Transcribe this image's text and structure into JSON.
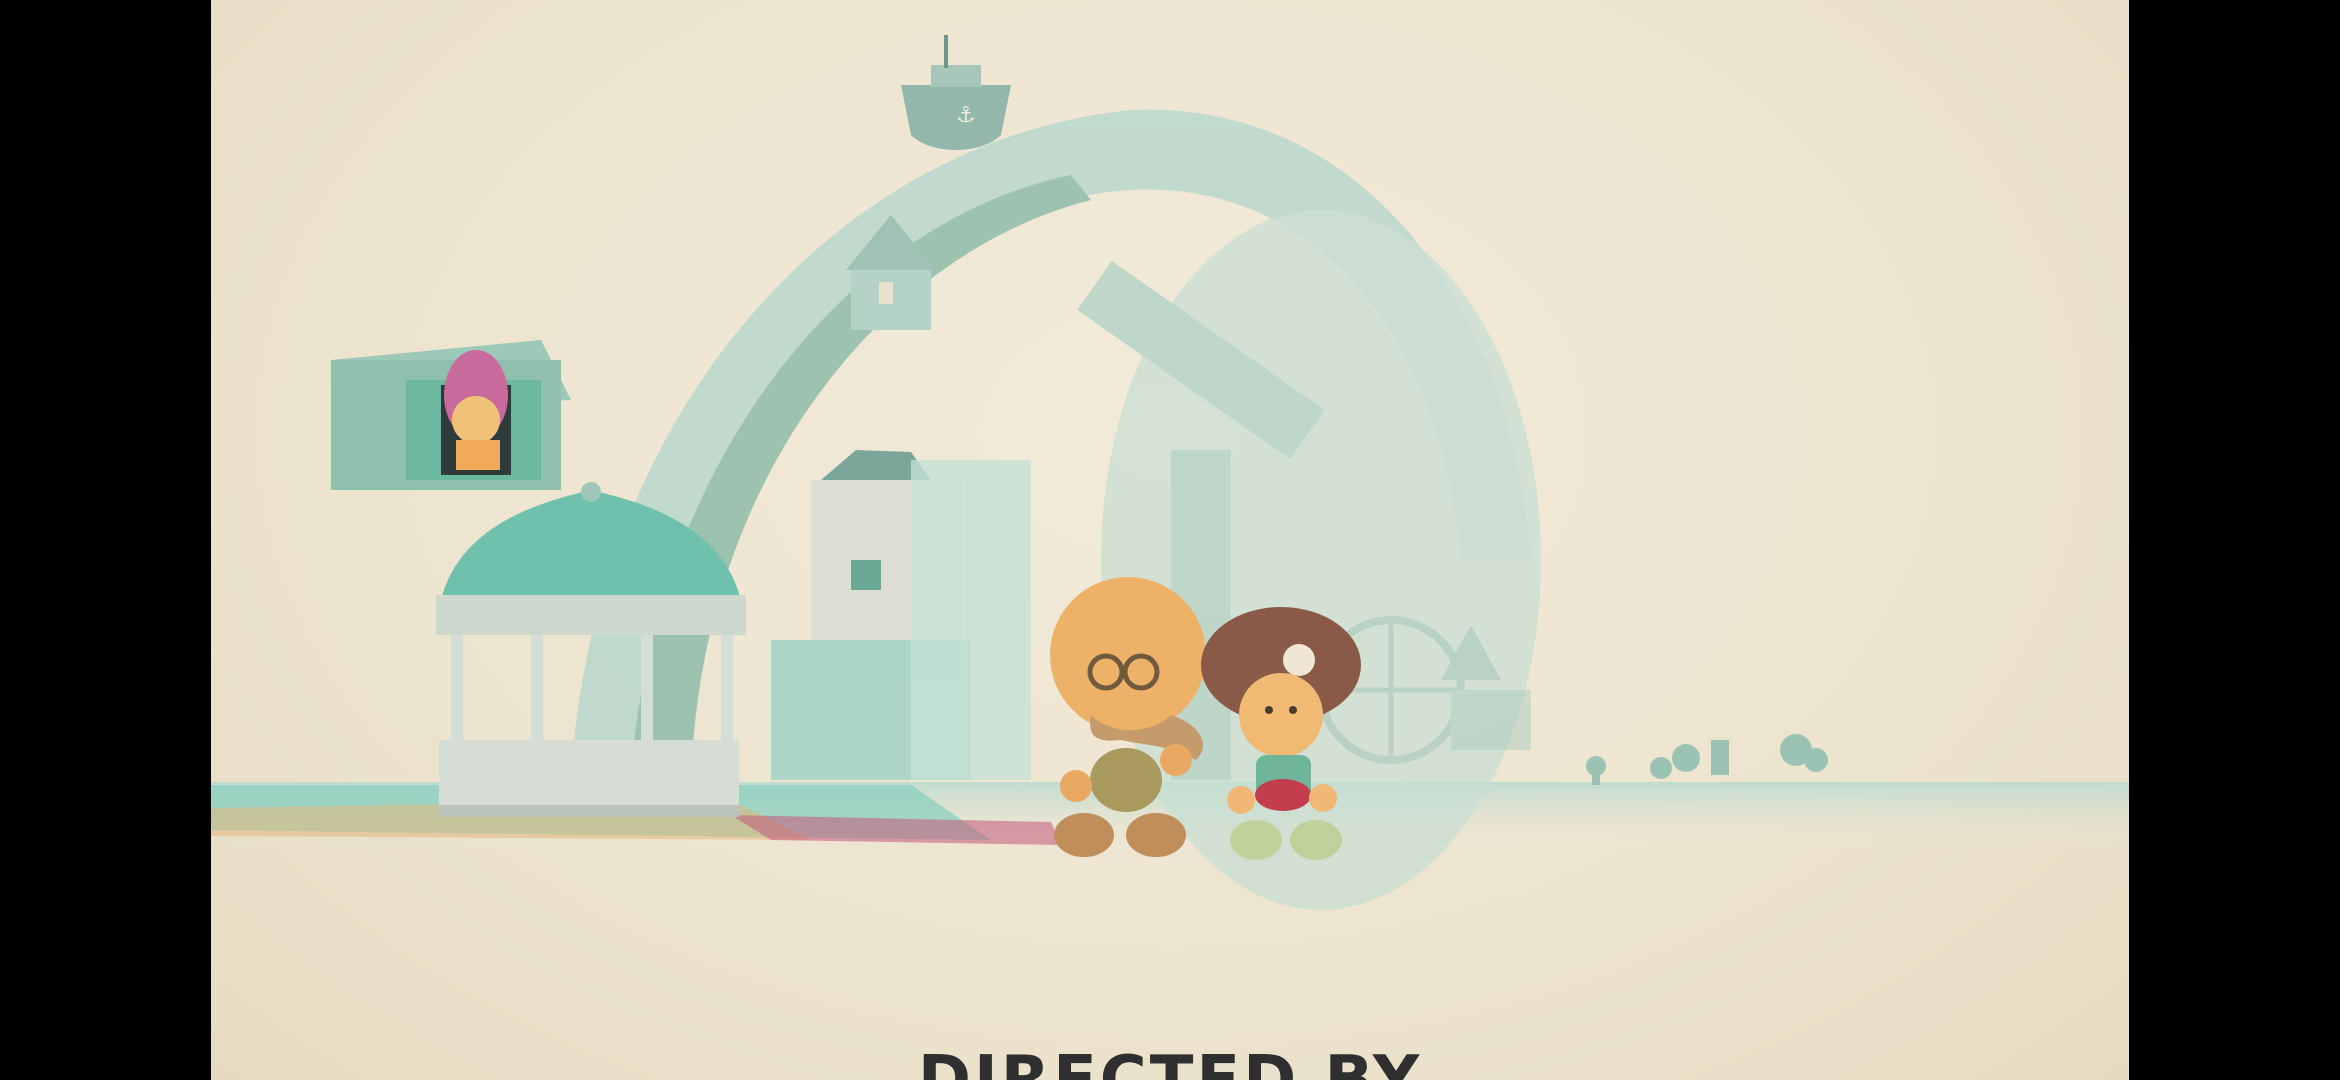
{
  "scene": {
    "credit_text": "DIRECTED BY",
    "colors": {
      "paper": "#efe7d4",
      "mint": "#a9d3c3",
      "mint_dark": "#7fb5a3",
      "teal": "#5fc2b0",
      "orange": "#f0b06a",
      "brown": "#8a5a48",
      "pink": "#c86a9b",
      "letterbox": "#000000"
    }
  }
}
